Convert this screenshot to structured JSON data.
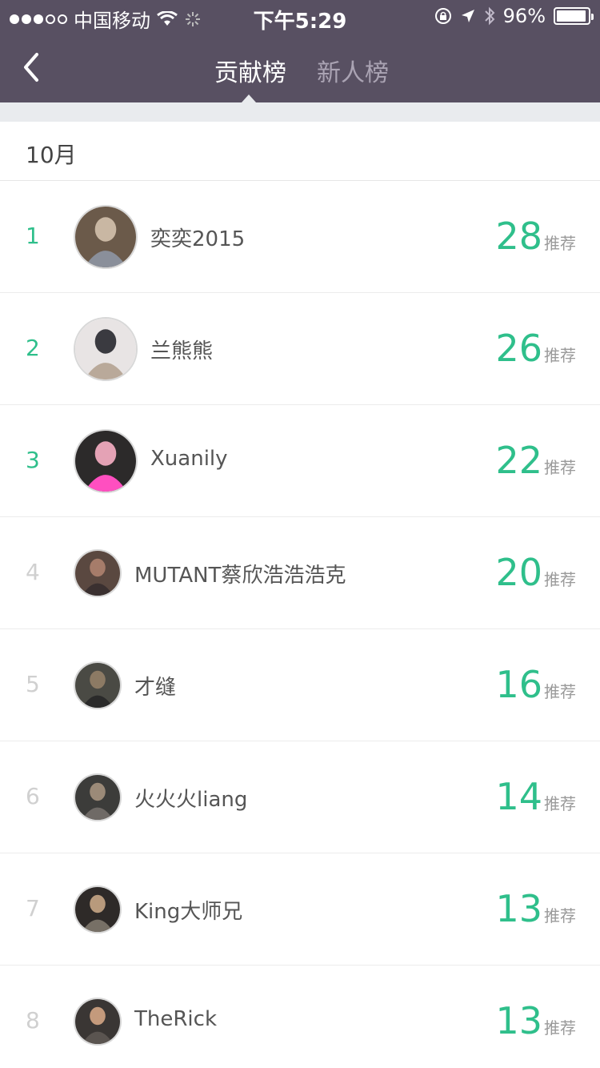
{
  "status": {
    "carrier": "中国移动",
    "time": "下午5:29",
    "battery": "96%",
    "battery_level": 0.96
  },
  "nav": {
    "tab_active": "贡献榜",
    "tab_inactive": "新人榜",
    "back_icon": "chevron-left-icon"
  },
  "section": {
    "month": "10月"
  },
  "unit_label": "推荐",
  "colors": {
    "topbar": "#585062",
    "accent": "#2fbf8b"
  },
  "ranking": [
    {
      "rank": "1",
      "name": "奕奕2015",
      "score": "28",
      "avatar": "gym-photo-avatar"
    },
    {
      "rank": "2",
      "name": "兰熊熊",
      "score": "26",
      "avatar": "fitness-photo-avatar"
    },
    {
      "rank": "3",
      "name": "Xuanily",
      "score": "22",
      "avatar": "portrait-photo-avatar"
    },
    {
      "rank": "4",
      "name": "MUTANT蔡欣浩浩浩克",
      "score": "20",
      "avatar": "muscle-photo-avatar"
    },
    {
      "rank": "5",
      "name": "才缝",
      "score": "16",
      "avatar": "gym-photo-avatar"
    },
    {
      "rank": "6",
      "name": "火火火liang",
      "score": "14",
      "avatar": "gym-photo-avatar"
    },
    {
      "rank": "7",
      "name": "King大师兄",
      "score": "13",
      "avatar": "workout-photo-avatar"
    },
    {
      "rank": "8",
      "name": "TheRick",
      "score": "13",
      "avatar": "selfie-photo-avatar"
    }
  ]
}
